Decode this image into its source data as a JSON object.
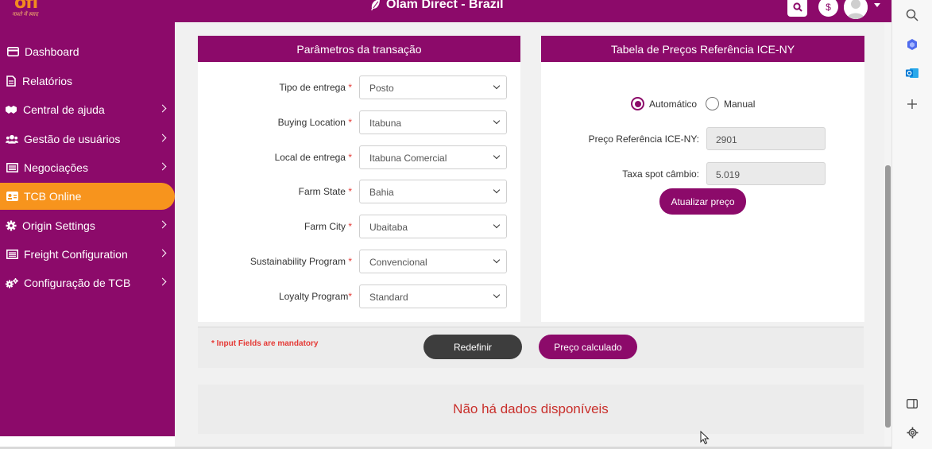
{
  "header": {
    "logo_text": "ofi",
    "logo_tagline": "नाश्ते में स्वाद",
    "title": "Olam Direct - Brazil",
    "currency_symbol": "$"
  },
  "sidebar": {
    "items": [
      {
        "label": "Dashboard",
        "icon": "card-icon",
        "chevron": false,
        "active": false
      },
      {
        "label": "Relatórios",
        "icon": "document-icon",
        "chevron": false,
        "active": false
      },
      {
        "label": "Central de ajuda",
        "icon": "handshake-icon",
        "chevron": true,
        "active": false
      },
      {
        "label": "Gestão de usuários",
        "icon": "users-icon",
        "chevron": true,
        "active": false
      },
      {
        "label": "Negociações",
        "icon": "list-icon",
        "chevron": true,
        "active": false
      },
      {
        "label": "TCB Online",
        "icon": "id-card-icon",
        "chevron": false,
        "active": true
      },
      {
        "label": "Origin Settings",
        "icon": "gear-icon",
        "chevron": true,
        "active": false
      },
      {
        "label": "Freight Configuration",
        "icon": "list-icon",
        "chevron": true,
        "active": false
      },
      {
        "label": "Configuração de TCB",
        "icon": "gears-icon",
        "chevron": true,
        "active": false
      }
    ]
  },
  "transaction_panel": {
    "title": "Parâmetros da transação",
    "fields": [
      {
        "label": "Tipo de entrega",
        "required_mark": " *",
        "value": "Posto"
      },
      {
        "label": "Buying Location",
        "required_mark": " *",
        "value": "Itabuna"
      },
      {
        "label": "Local de entrega",
        "required_mark": " *",
        "value": "Itabuna Comercial"
      },
      {
        "label": "Farm State",
        "required_mark": " *",
        "value": "Bahia"
      },
      {
        "label": "Farm City",
        "required_mark": " *",
        "value": "Ubaitaba"
      },
      {
        "label": "Sustainability Program",
        "required_mark": " *",
        "value": "Convencional"
      },
      {
        "label": "Loyalty Program",
        "required_mark": "*",
        "value": "Standard"
      }
    ]
  },
  "price_panel": {
    "title": "Tabela de Preços Referência ICE-NY",
    "radio_auto": "Automático",
    "radio_manual": "Manual",
    "selected_mode": "Automático",
    "ref_price_label": "Preço Referência ICE-NY:",
    "ref_price_value": "2901",
    "spot_rate_label": "Taxa spot câmbio:",
    "spot_rate_value": "5.019",
    "update_button": "Atualizar preço"
  },
  "actions": {
    "mandatory_note": "* Input Fields are mandatory",
    "reset_button": "Redefinir",
    "calculate_button": "Preço calculado"
  },
  "results": {
    "empty_message": "Não há dados disponíveis"
  },
  "colors": {
    "brand": "#8c0a6a",
    "active_nav": "#f7941d",
    "required": "#e53935",
    "empty_text": "#c9302c"
  }
}
